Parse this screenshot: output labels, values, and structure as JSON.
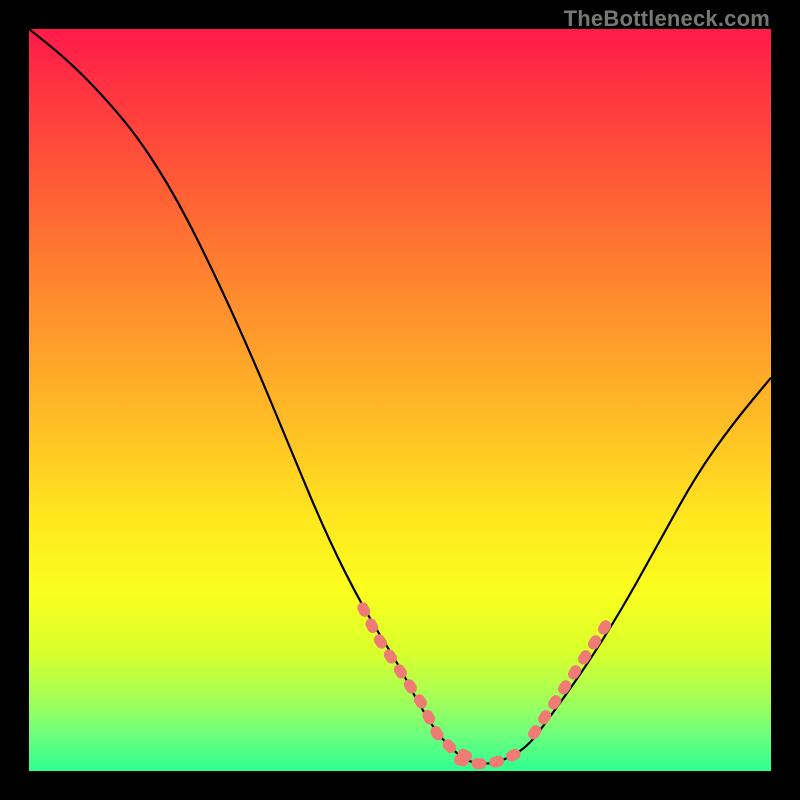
{
  "watermark": "TheBottleneck.com",
  "chart_data": {
    "type": "line",
    "title": "",
    "xlabel": "",
    "ylabel": "",
    "xlim": [
      0,
      100
    ],
    "ylim": [
      0,
      100
    ],
    "grid": false,
    "legend": false,
    "series": [
      {
        "name": "curve",
        "x": [
          0,
          5,
          10,
          15,
          20,
          25,
          30,
          35,
          40,
          45,
          50,
          52,
          55,
          58,
          60,
          63,
          67,
          70,
          75,
          80,
          85,
          90,
          95,
          100
        ],
        "values": [
          100,
          96,
          91,
          85,
          77,
          67,
          56,
          44,
          32,
          22,
          14,
          10,
          5,
          2,
          1,
          1,
          3,
          7,
          14,
          22,
          31,
          40,
          47,
          53
        ],
        "color": "#000000"
      },
      {
        "name": "highlight-left",
        "x": [
          45,
          47,
          49,
          51,
          53,
          55,
          57,
          59
        ],
        "values": [
          22,
          18,
          15,
          12,
          9,
          5,
          3,
          2
        ],
        "color": "#ef7c74"
      },
      {
        "name": "highlight-bottom",
        "x": [
          58,
          60,
          62,
          64,
          66
        ],
        "values": [
          1.5,
          1,
          1,
          1.5,
          2.5
        ],
        "color": "#ef7c74"
      },
      {
        "name": "highlight-right",
        "x": [
          68,
          70,
          72,
          74,
          76,
          78
        ],
        "values": [
          5,
          8,
          11,
          14,
          17,
          20
        ],
        "color": "#ef7c74"
      }
    ],
    "background_gradient": {
      "direction": "vertical",
      "stops": [
        {
          "pos": 0.0,
          "color": "#ff1a4a"
        },
        {
          "pos": 0.1,
          "color": "#ff3a3f"
        },
        {
          "pos": 0.22,
          "color": "#ff5f35"
        },
        {
          "pos": 0.36,
          "color": "#ff8b2e"
        },
        {
          "pos": 0.5,
          "color": "#ffb427"
        },
        {
          "pos": 0.66,
          "color": "#ffe71f"
        },
        {
          "pos": 0.76,
          "color": "#faff1f"
        },
        {
          "pos": 0.84,
          "color": "#d8ff2c"
        },
        {
          "pos": 0.9,
          "color": "#a7ff56"
        },
        {
          "pos": 0.95,
          "color": "#6fff7c"
        },
        {
          "pos": 1.0,
          "color": "#2eff91"
        }
      ]
    }
  }
}
